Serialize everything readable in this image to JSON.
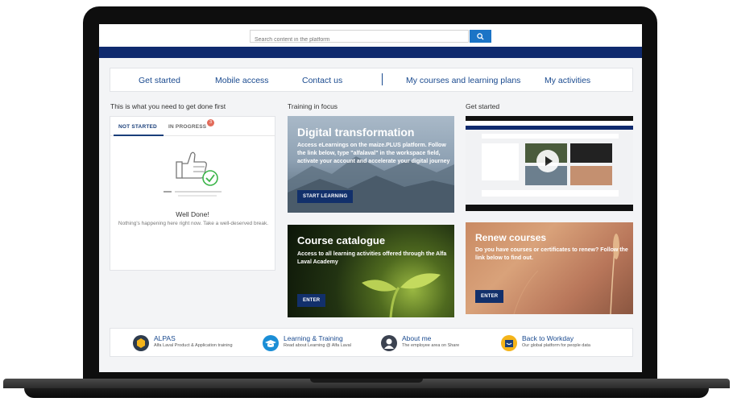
{
  "search": {
    "placeholder": "Search content in the platform"
  },
  "quick_nav": [
    "Get started",
    "Mobile access",
    "Contact us",
    "My courses and learning plans",
    "My activities"
  ],
  "sections": {
    "todo_title": "This is what you need to get done first",
    "focus_title": "Training in focus",
    "getstarted_title": "Get started"
  },
  "todo": {
    "tab_not_started": "NOT STARTED",
    "tab_in_progress": "IN PROGRESS",
    "in_progress_count": "3",
    "done_title": "Well Done!",
    "done_text": "Nothing's happening here right now. Take a well-deserved break."
  },
  "cards": {
    "digital": {
      "title": "Digital transformation",
      "text": "Access eLearnings on the maize.PLUS platform. Follow the link below, type \"alfalaval\" in the workspace field, activate your account and accelerate your digital journey",
      "button": "START LEARNING"
    },
    "catalog": {
      "title": "Course catalogue",
      "text": "Access to all learning activities offered through the Alfa Laval Academy",
      "button": "ENTER"
    },
    "renew": {
      "title": "Renew courses",
      "text": "Do you have courses or certificates to renew? Follow the link below to find out.",
      "button": "ENTER"
    }
  },
  "bottom_links": [
    {
      "title": "ALPAS",
      "subtitle": "Alfa Laval Product & Application training",
      "icon": "alpas-cube-icon",
      "color": "#2d3b4d"
    },
    {
      "title": "Learning & Training",
      "subtitle": "Read about Learning @ Alfa Laval",
      "icon": "graduation-cap-icon",
      "color": "#1b8ed6"
    },
    {
      "title": "About me",
      "subtitle": "The employee area on Share",
      "icon": "person-icon",
      "color": "#3b4250"
    },
    {
      "title": "Back to Workday",
      "subtitle": "Our global platform for people data",
      "icon": "workday-icon",
      "color": "#f4b41a"
    }
  ],
  "colors": {
    "nav_band": "#0f2a6e",
    "link_blue": "#1a4a8f",
    "button_navy": "#12306b",
    "search_blue": "#1b74c6",
    "success_green": "#3cb54a"
  }
}
